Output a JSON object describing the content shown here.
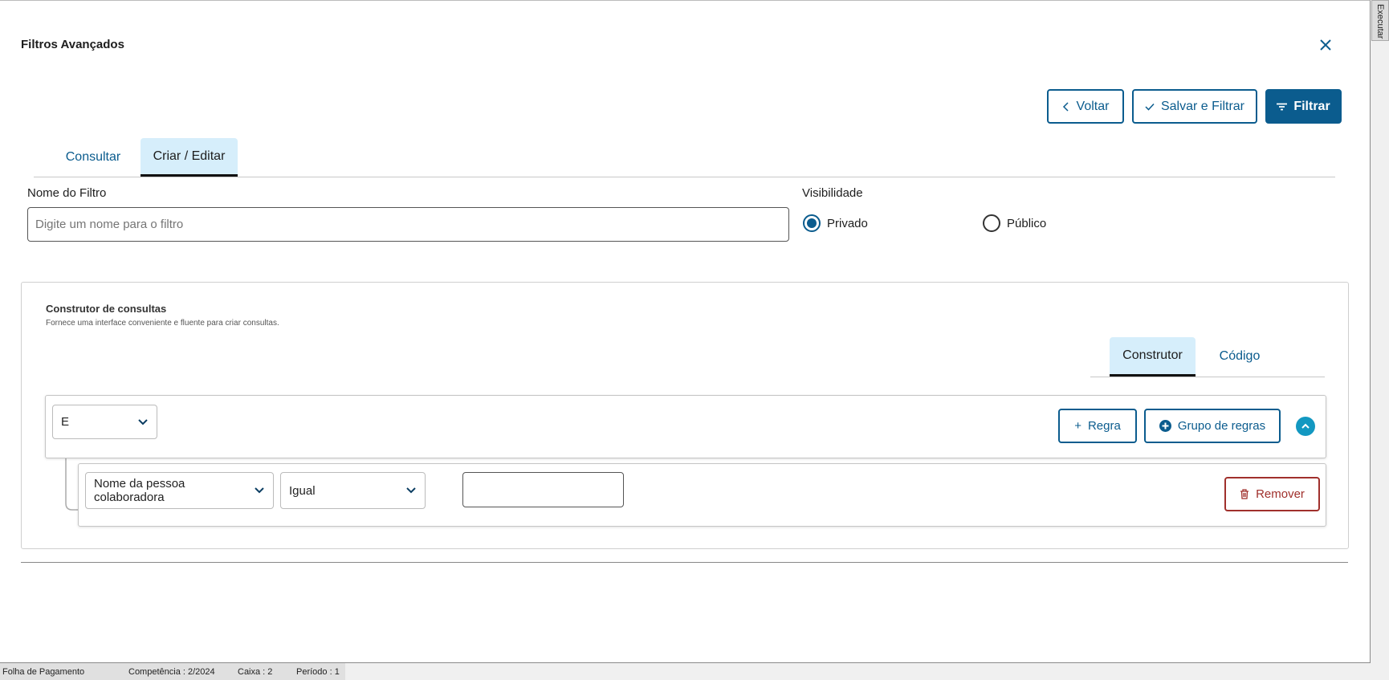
{
  "dialog": {
    "title": "Filtros Avançados",
    "close_icon": "close-icon"
  },
  "actions": {
    "back": "Voltar",
    "save_filter": "Salvar e Filtrar",
    "filter": "Filtrar"
  },
  "tabs": [
    {
      "label": "Consultar",
      "active": false
    },
    {
      "label": "Criar / Editar",
      "active": true
    }
  ],
  "form": {
    "name_label": "Nome do Filtro",
    "name_placeholder": "Digite um nome para o filtro",
    "name_value": "",
    "visibility_label": "Visibilidade",
    "visibility_options": [
      {
        "label": "Privado",
        "selected": true
      },
      {
        "label": "Público",
        "selected": false
      }
    ]
  },
  "query_builder": {
    "title": "Construtor de consultas",
    "subtitle": "Fornece uma interface conveniente e fluente para criar consultas.",
    "tabs": [
      {
        "label": "Construtor",
        "active": true
      },
      {
        "label": "Código",
        "active": false
      }
    ],
    "group": {
      "condition": "E",
      "add_rule": "Regra",
      "add_group": "Grupo de regras"
    },
    "rule": {
      "field": "Nome da pessoa colaboradora",
      "operator": "Igual",
      "value": "",
      "remove": "Remover"
    }
  },
  "side_tab": "Executar",
  "status_bar": {
    "module": "Folha de Pagamento",
    "competencia": "Competência : 2/2024",
    "caixa": "Caixa : 2",
    "periodo": "Período : 1"
  },
  "colors": {
    "primary": "#0b5c8e",
    "tab_active_bg": "#d6eefb",
    "danger": "#a0302c",
    "collapse": "#1398c1"
  }
}
